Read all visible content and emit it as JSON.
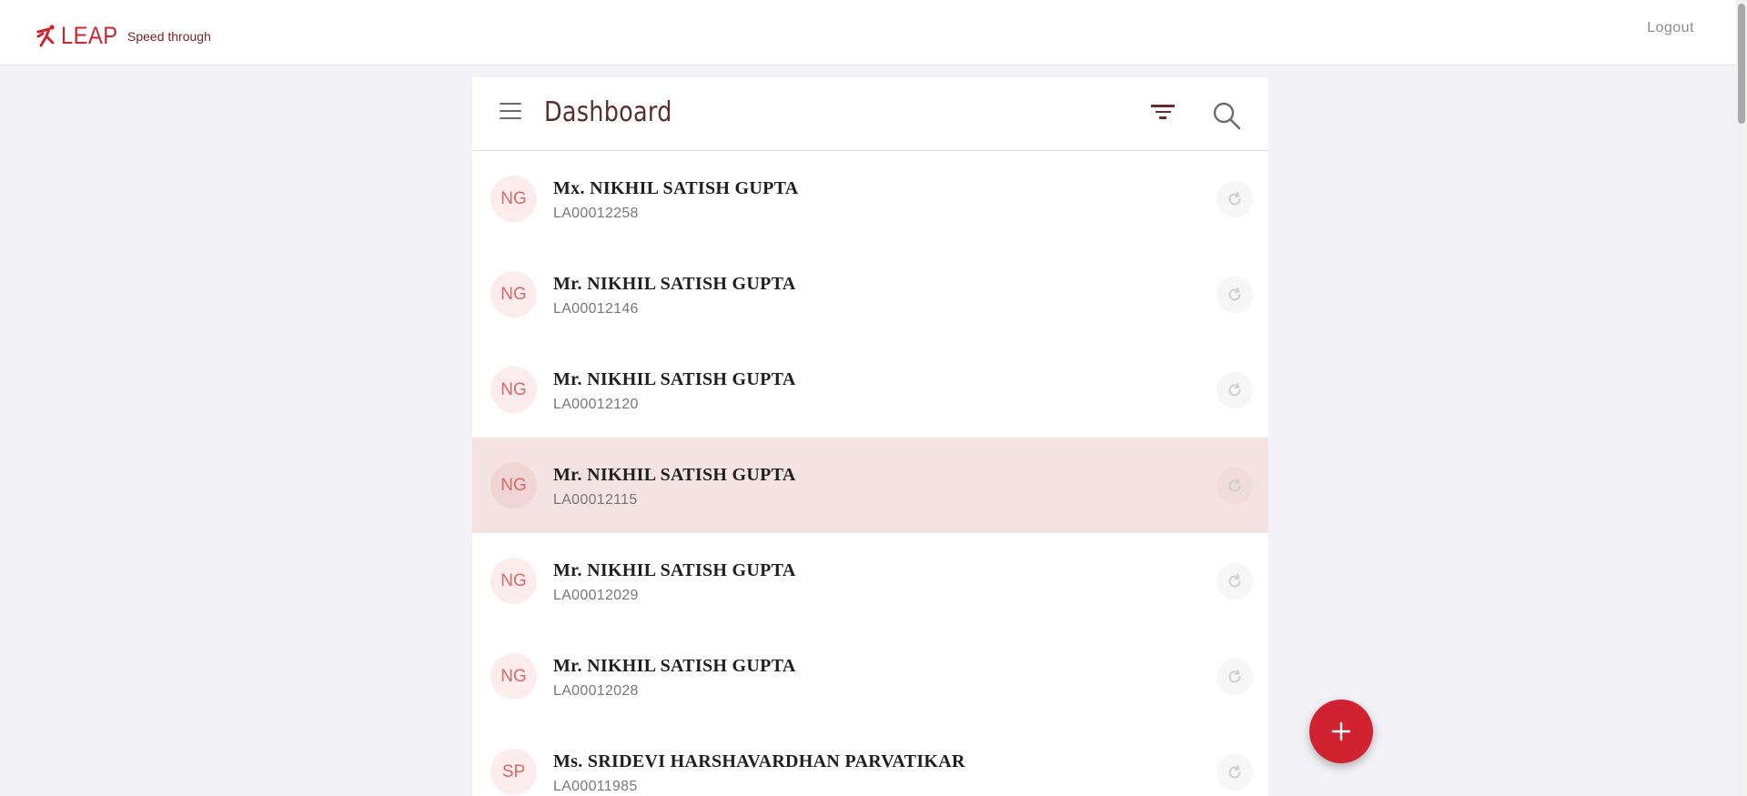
{
  "header": {
    "brand_name": "LEAP",
    "tagline": "Speed through",
    "logout_label": "Logout",
    "brand_color": "#cc2530"
  },
  "panel": {
    "menu_icon": "hamburger-menu-icon",
    "title": "Dashboard",
    "filter_icon": "filter-icon",
    "search_icon": "search-icon"
  },
  "records": [
    {
      "initials": "NG",
      "name": "Mx. NIKHIL SATISH GUPTA",
      "account": "LA00012258"
    },
    {
      "initials": "NG",
      "name": "Mr. NIKHIL SATISH GUPTA",
      "account": "LA00012146"
    },
    {
      "initials": "NG",
      "name": "Mr. NIKHIL SATISH GUPTA",
      "account": "LA00012120"
    },
    {
      "initials": "NG",
      "name": "Mr. NIKHIL SATISH GUPTA",
      "account": "LA00012115"
    },
    {
      "initials": "NG",
      "name": "Mr. NIKHIL SATISH GUPTA",
      "account": "LA00012029"
    },
    {
      "initials": "NG",
      "name": "Mr. NIKHIL SATISH GUPTA",
      "account": "LA00012028"
    },
    {
      "initials": "SP",
      "name": "Ms. SRIDEVI HARSHAVARDHAN PARVATIKAR",
      "account": "LA00011985"
    }
  ],
  "highlighted_row": 3,
  "row_action_icon": "refresh-icon",
  "fab": {
    "icon": "plus-icon",
    "color": "#d02231"
  }
}
